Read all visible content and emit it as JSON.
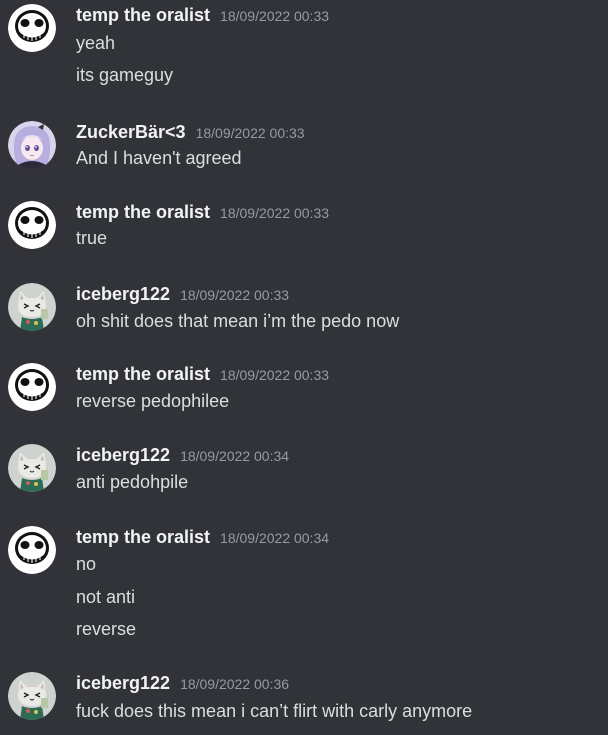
{
  "colors": {
    "background": "#313338",
    "username": "#f2f3f5",
    "timestamp": "#949ba4",
    "message_text": "#dbdee1"
  },
  "messages": [
    {
      "author": "temp the oralist",
      "avatar": "skull-avatar",
      "timestamp": "18/09/2022 00:33",
      "lines": [
        "yeah",
        "its gameguy"
      ]
    },
    {
      "author": "ZuckerBär<3",
      "avatar": "anime-girl-avatar",
      "timestamp": "18/09/2022 00:33",
      "lines": [
        "And I haven't agreed"
      ]
    },
    {
      "author": "temp the oralist",
      "avatar": "skull-avatar",
      "timestamp": "18/09/2022 00:33",
      "lines": [
        "true"
      ]
    },
    {
      "author": "iceberg122",
      "avatar": "cat-avatar",
      "timestamp": "18/09/2022 00:33",
      "lines": [
        "oh shit does that mean i’m the pedo now"
      ]
    },
    {
      "author": "temp the oralist",
      "avatar": "skull-avatar",
      "timestamp": "18/09/2022 00:33",
      "lines": [
        "reverse pedophilee"
      ]
    },
    {
      "author": "iceberg122",
      "avatar": "cat-avatar",
      "timestamp": "18/09/2022 00:34",
      "lines": [
        "anti pedohpile"
      ]
    },
    {
      "author": "temp the oralist",
      "avatar": "skull-avatar",
      "timestamp": "18/09/2022 00:34",
      "lines": [
        "no",
        "not anti",
        "reverse"
      ]
    },
    {
      "author": "iceberg122",
      "avatar": "cat-avatar",
      "timestamp": "18/09/2022 00:36",
      "lines": [
        "fuck does this mean i can’t flirt with carly anymore"
      ]
    }
  ]
}
